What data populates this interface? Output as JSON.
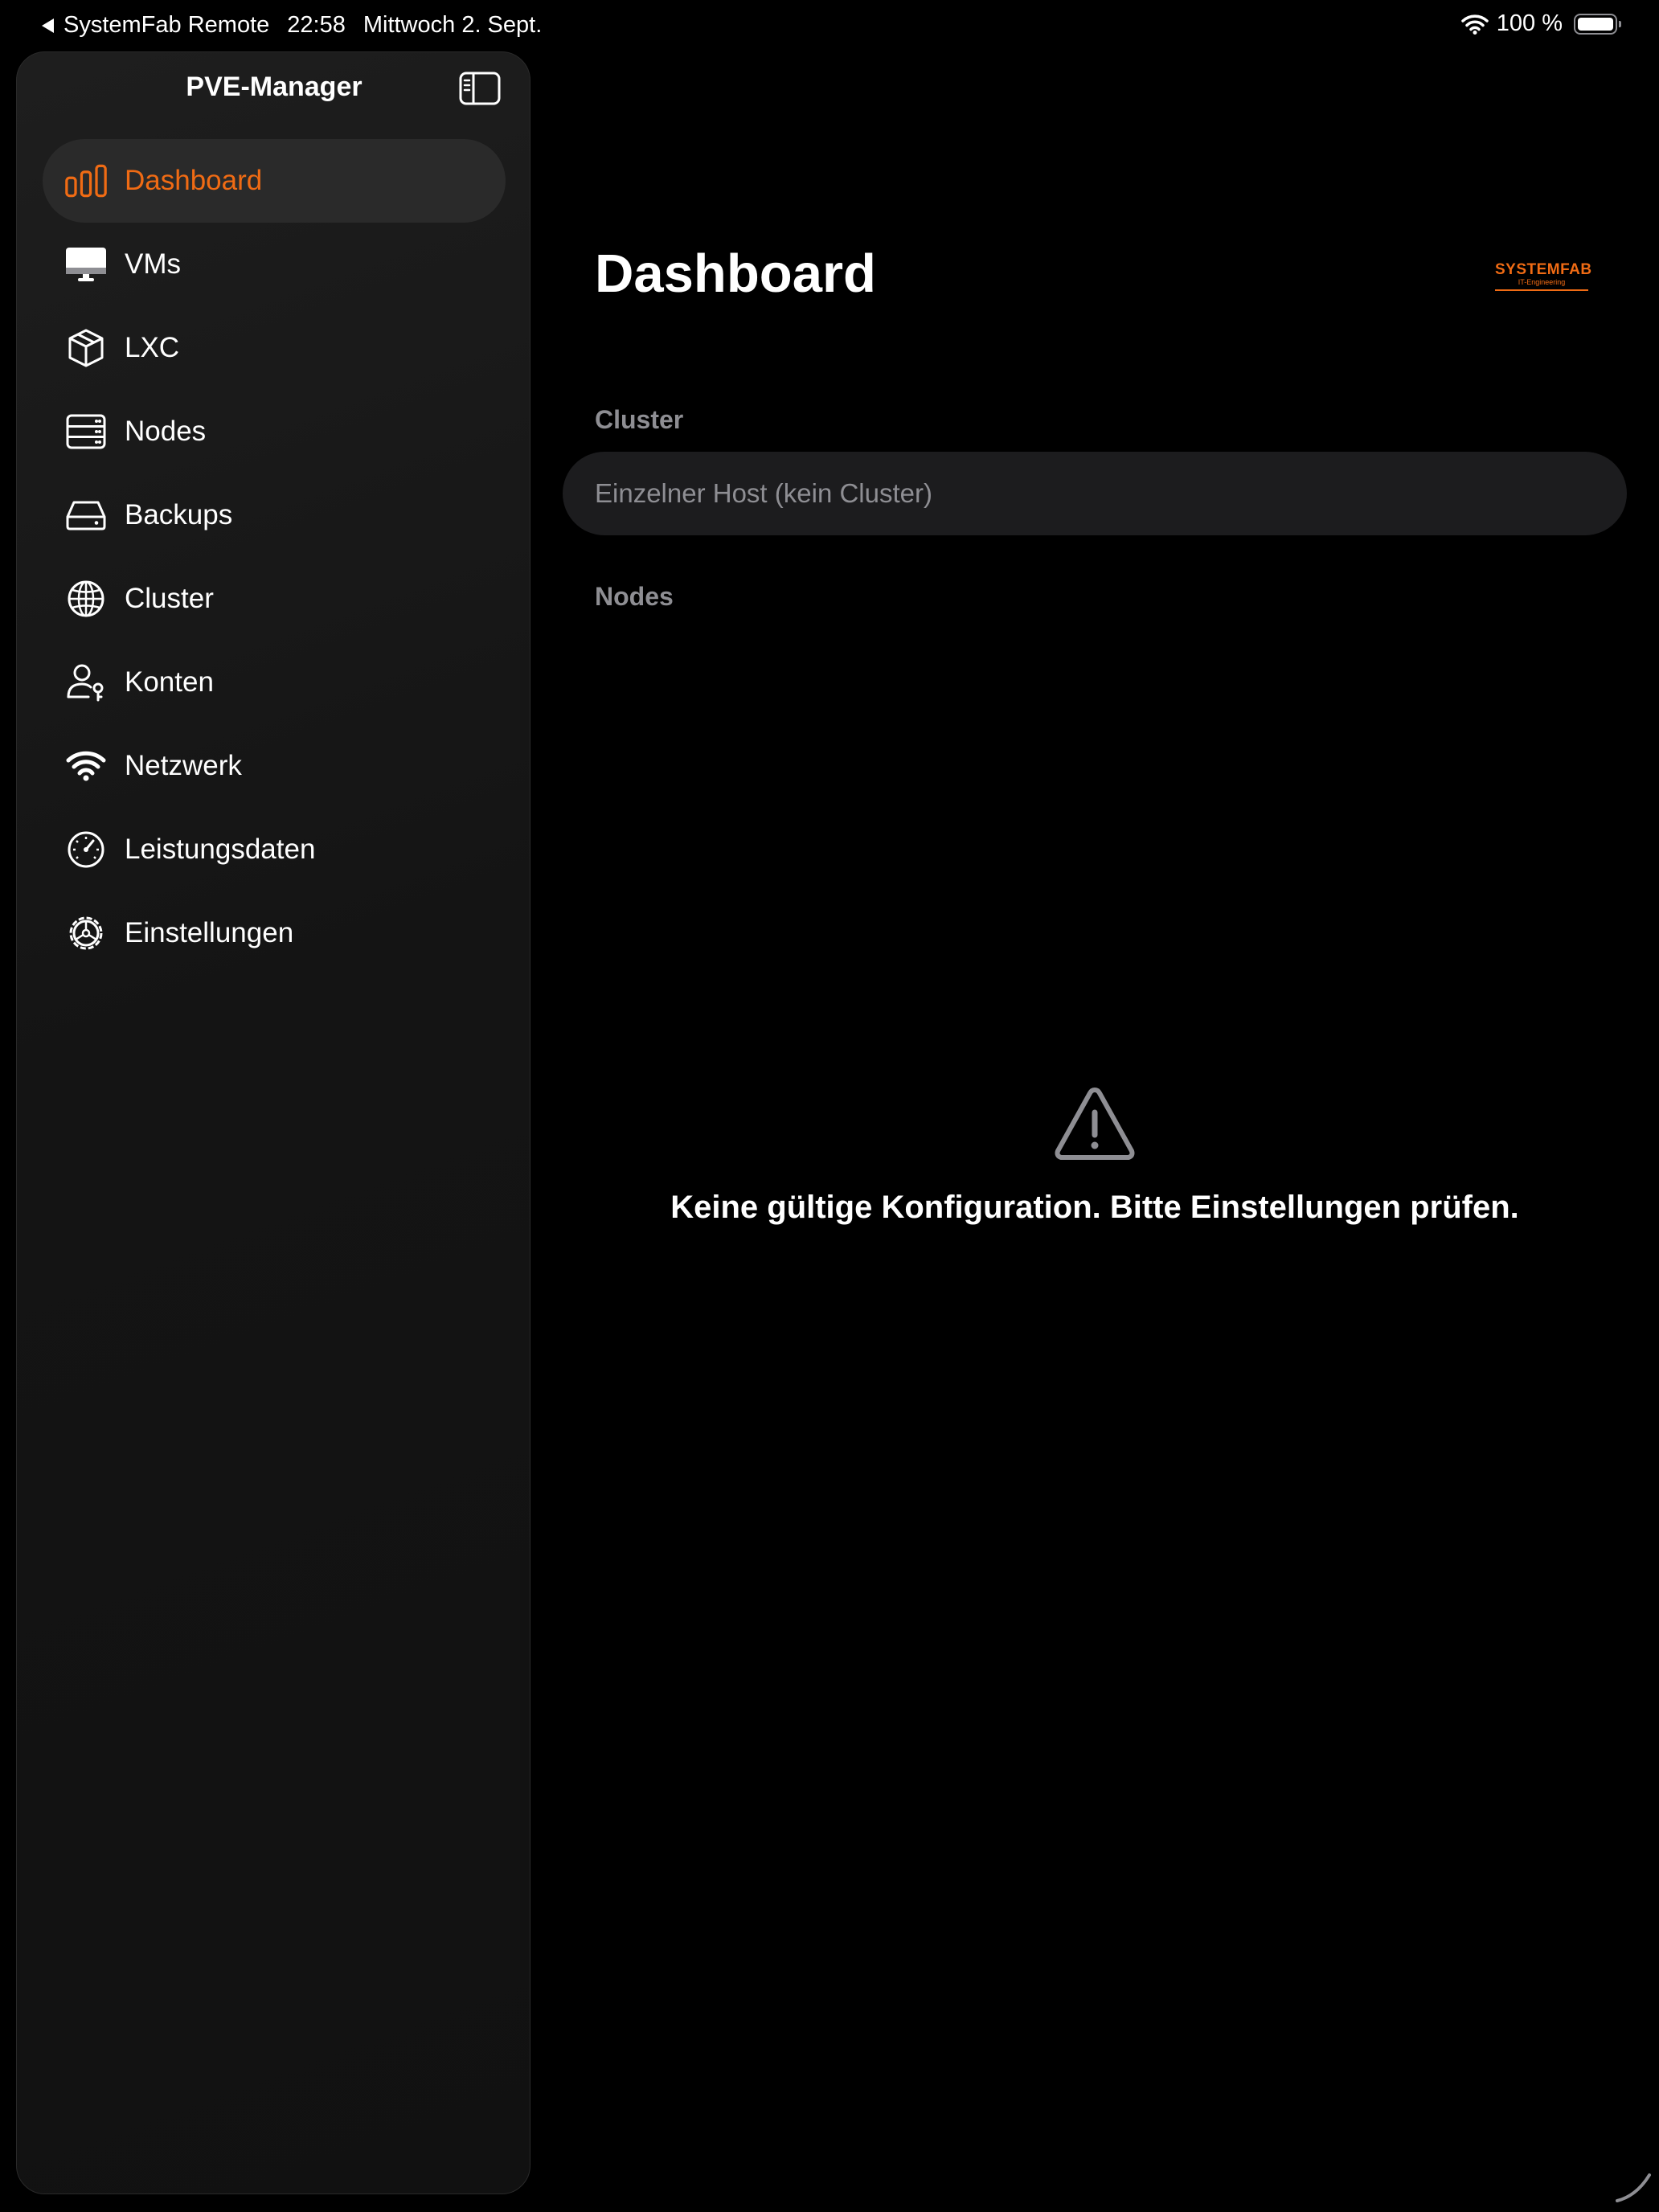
{
  "status_bar": {
    "back_app": "SystemFab Remote",
    "time": "22:58",
    "date": "Mittwoch 2. Sept.",
    "battery": "100 %",
    "battery_level": 1.0
  },
  "sidebar": {
    "title": "PVE-Manager",
    "items": [
      {
        "label": "Dashboard",
        "icon": "chart-bar-icon",
        "active": true
      },
      {
        "label": "VMs",
        "icon": "display-icon"
      },
      {
        "label": "LXC",
        "icon": "cube-icon"
      },
      {
        "label": "Nodes",
        "icon": "server-rack-icon"
      },
      {
        "label": "Backups",
        "icon": "drive-icon"
      },
      {
        "label": "Cluster",
        "icon": "globe-icon"
      },
      {
        "label": "Konten",
        "icon": "person-key-icon"
      },
      {
        "label": "Netzwerk",
        "icon": "wifi-icon"
      },
      {
        "label": "Leistungsdaten",
        "icon": "gauge-icon"
      },
      {
        "label": "Einstellungen",
        "icon": "gear-icon"
      }
    ]
  },
  "main": {
    "title": "Dashboard",
    "logo": {
      "name": "SYSTEMFAB",
      "tagline": "IT-Engineering"
    },
    "cluster_section": "Cluster",
    "cluster_value": "Einzelner Host (kein Cluster)",
    "nodes_section": "Nodes",
    "empty_message": "Keine gültige Konfiguration. Bitte Einstellungen prüfen."
  },
  "colors": {
    "accent": "#f06b14",
    "background": "#000000",
    "card": "#1c1c1e",
    "secondary_text": "#8e8e93"
  }
}
